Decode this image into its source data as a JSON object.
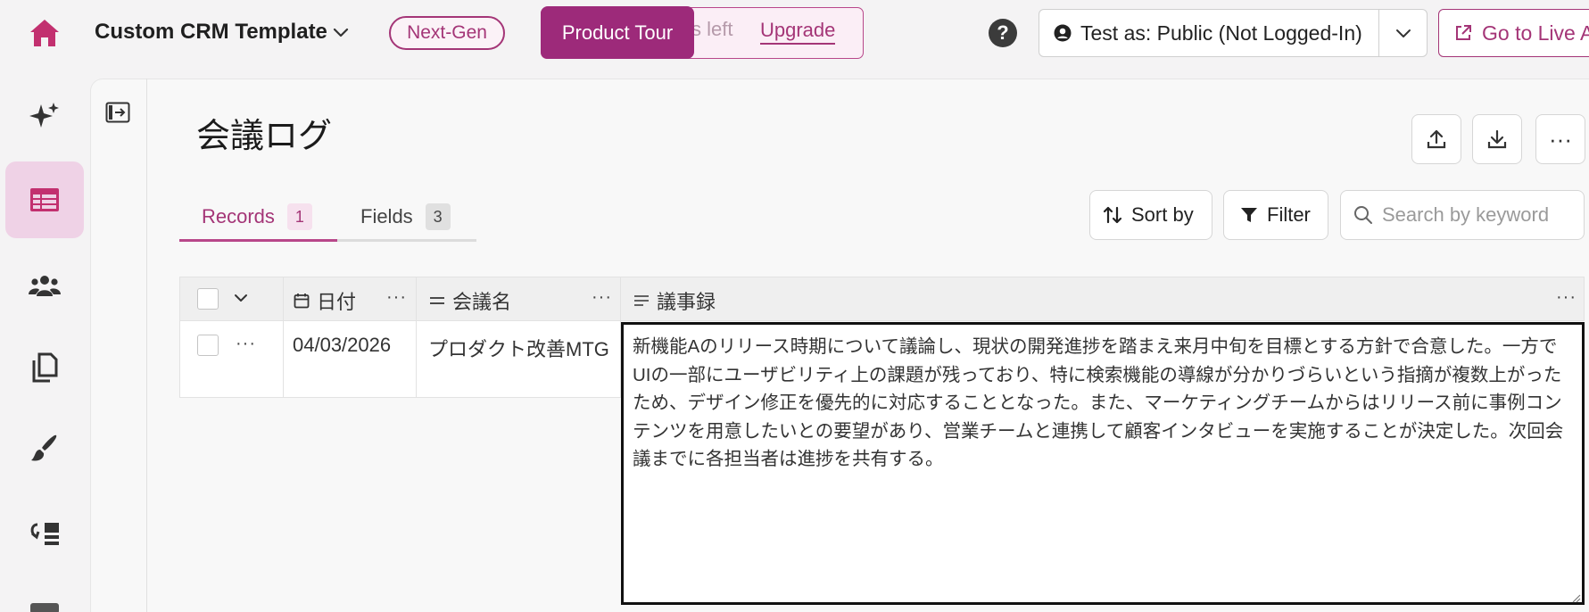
{
  "header": {
    "app_title": "Custom CRM Template",
    "next_gen_label": "Next-Gen",
    "trial_text": "ys left",
    "upgrade_label": "Upgrade",
    "product_tour_label": "Product Tour",
    "help_label": "?",
    "test_as_label": "Test as: Public (Not Logged-In)",
    "go_live_label": "Go to Live A"
  },
  "sidebar": {
    "items": [
      {
        "name": "ai",
        "icon": "sparkles-icon"
      },
      {
        "name": "tables",
        "icon": "table-icon",
        "active": true
      },
      {
        "name": "users",
        "icon": "users-icon"
      },
      {
        "name": "pages",
        "icon": "pages-icon"
      },
      {
        "name": "design",
        "icon": "brush-icon"
      },
      {
        "name": "workflows",
        "icon": "workflow-icon"
      }
    ]
  },
  "page": {
    "title": "会議ログ",
    "tabs": [
      {
        "label": "Records",
        "count": "1"
      },
      {
        "label": "Fields",
        "count": "3"
      }
    ],
    "toolbar": {
      "sort_label": "Sort by",
      "filter_label": "Filter",
      "search_placeholder": "Search by keyword",
      "more_label": "···"
    }
  },
  "table": {
    "columns": [
      {
        "label": "日付",
        "icon": "calendar-icon"
      },
      {
        "label": "会議名",
        "icon": "short-text-icon"
      },
      {
        "label": "議事録",
        "icon": "long-text-icon"
      }
    ],
    "rows": [
      {
        "date": "04/03/2026",
        "name": "プロダクト改善MTG",
        "minutes": "新機能Aのリリース時期について議論し、現状の開発進捗を踏まえ来月中旬を目標とする方針で合意した。一方でUIの一部にユーザビリティ上の課題が残っており、特に検索機能の導線が分かりづらいという指摘が複数上がったため、デザイン修正を優先的に対応することとなった。また、マーケティングチームからはリリース前に事例コンテンツを用意したいとの要望があり、営業チームと連携して顧客インタビューを実施することが決定した。次回会議までに各担当者は進捗を共有する。"
      }
    ]
  },
  "colors": {
    "accent": "#a43577",
    "accent_dark": "#9d2a7a",
    "active_bg": "#efd2e6"
  }
}
